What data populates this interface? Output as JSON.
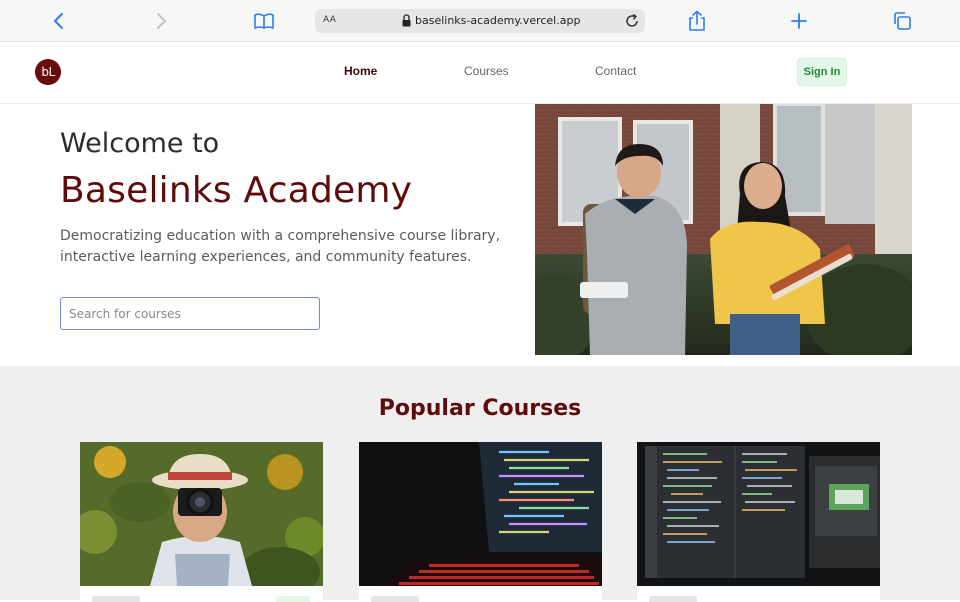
{
  "browser": {
    "aa_label": "AA",
    "url": "baselinks-academy.vercel.app",
    "icons": [
      "back-icon",
      "forward-icon",
      "bookmarks-icon",
      "lock-icon",
      "reload-icon",
      "share-icon",
      "new-tab-icon",
      "tabs-icon"
    ]
  },
  "header": {
    "logo_text": "bL",
    "nav": [
      {
        "label": "Home",
        "active": true
      },
      {
        "label": "Courses",
        "active": false
      },
      {
        "label": "Contact",
        "active": false
      }
    ],
    "signin_label": "Sign In"
  },
  "hero": {
    "welcome": "Welcome to",
    "title": "Baselinks Academy",
    "description": "Democratizing education with a comprehensive course library, interactive learning experiences, and community features.",
    "search_placeholder": "Search for courses",
    "image_alt": "two students walking with books"
  },
  "popular": {
    "title": "Popular Courses",
    "courses": [
      {
        "image": "photographer with camera in sunflower field"
      },
      {
        "image": "laptop with code on screen"
      },
      {
        "image": "monitors with code editors"
      }
    ]
  },
  "colors": {
    "brand": "#5e0b0b",
    "signin_bg": "#e3f7e8",
    "signin_text": "#1f8a3b",
    "section_bg": "#efefef"
  }
}
